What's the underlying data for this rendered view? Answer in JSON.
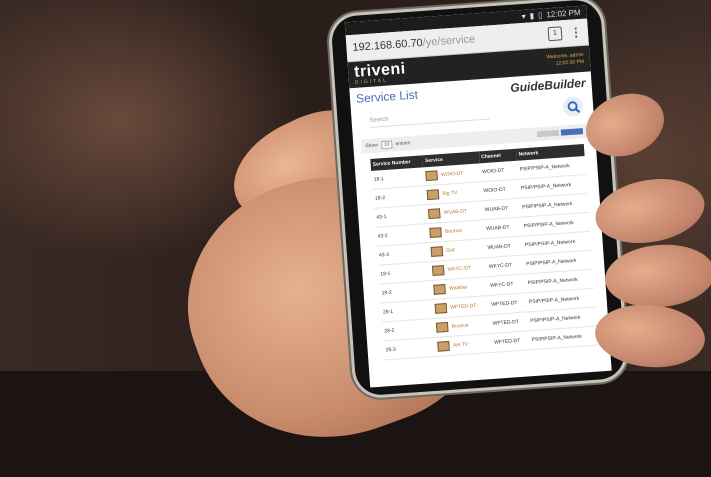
{
  "phone": {
    "status": {
      "time": "12:02 PM"
    },
    "browser": {
      "url_host": "192.168.60.70",
      "url_path": "/ye/service",
      "tab_count": "1",
      "menu_glyph": "⋮"
    },
    "app": {
      "brand": "triveni",
      "brand_sub": "DIGITAL",
      "welcome": "Welcome, admin",
      "time": "12:02:30 PM",
      "title": "Service List",
      "product": "GuideBuilder",
      "search_placeholder": "Search",
      "show_label": "Show",
      "show_value": "10",
      "entries_label": "entries",
      "columns": [
        "Service Number",
        "Service",
        "Channel",
        "Network"
      ],
      "rows": [
        {
          "num": "18-1",
          "service": "WOIO-DT",
          "channel": "WOIO-DT",
          "network": "PSIP/PSIP-A_Network"
        },
        {
          "num": "18-2",
          "service": "Big TV",
          "channel": "WOIO-DT",
          "network": "PSIP/PSIP-A_Network"
        },
        {
          "num": "43-1",
          "service": "WUAB-DT",
          "channel": "WUAB-DT",
          "network": "PSIP/PSIP-A_Network"
        },
        {
          "num": "43-2",
          "service": "Bounce",
          "channel": "WUAB-DT",
          "network": "PSIP/PSIP-A_Network"
        },
        {
          "num": "43-3",
          "service": "Grit",
          "channel": "WUAB-DT",
          "network": "PSIP/PSIP-A_Network"
        },
        {
          "num": "19-1",
          "service": "WKYC-DT",
          "channel": "WKYC-DT",
          "network": "PSIP/PSIP-A_Network"
        },
        {
          "num": "19-2",
          "service": "Weather",
          "channel": "WKYC-DT",
          "network": "PSIP/PSIP-A_Network"
        },
        {
          "num": "28-1",
          "service": "WFTED-DT",
          "channel": "WFTED-DT",
          "network": "PSIP/PSIP-A_Network"
        },
        {
          "num": "28-2",
          "service": "Bounce",
          "channel": "WFTED-DT",
          "network": "PSIP/PSIP-A_Network"
        },
        {
          "num": "28-3",
          "service": "Ant TV",
          "channel": "WFTED-DT",
          "network": "PSIP/PSIP-A_Network"
        }
      ]
    }
  },
  "colors": {
    "accent": "#4a6fb5",
    "brand_bar": "#222222",
    "service_link": "#c0772a"
  }
}
